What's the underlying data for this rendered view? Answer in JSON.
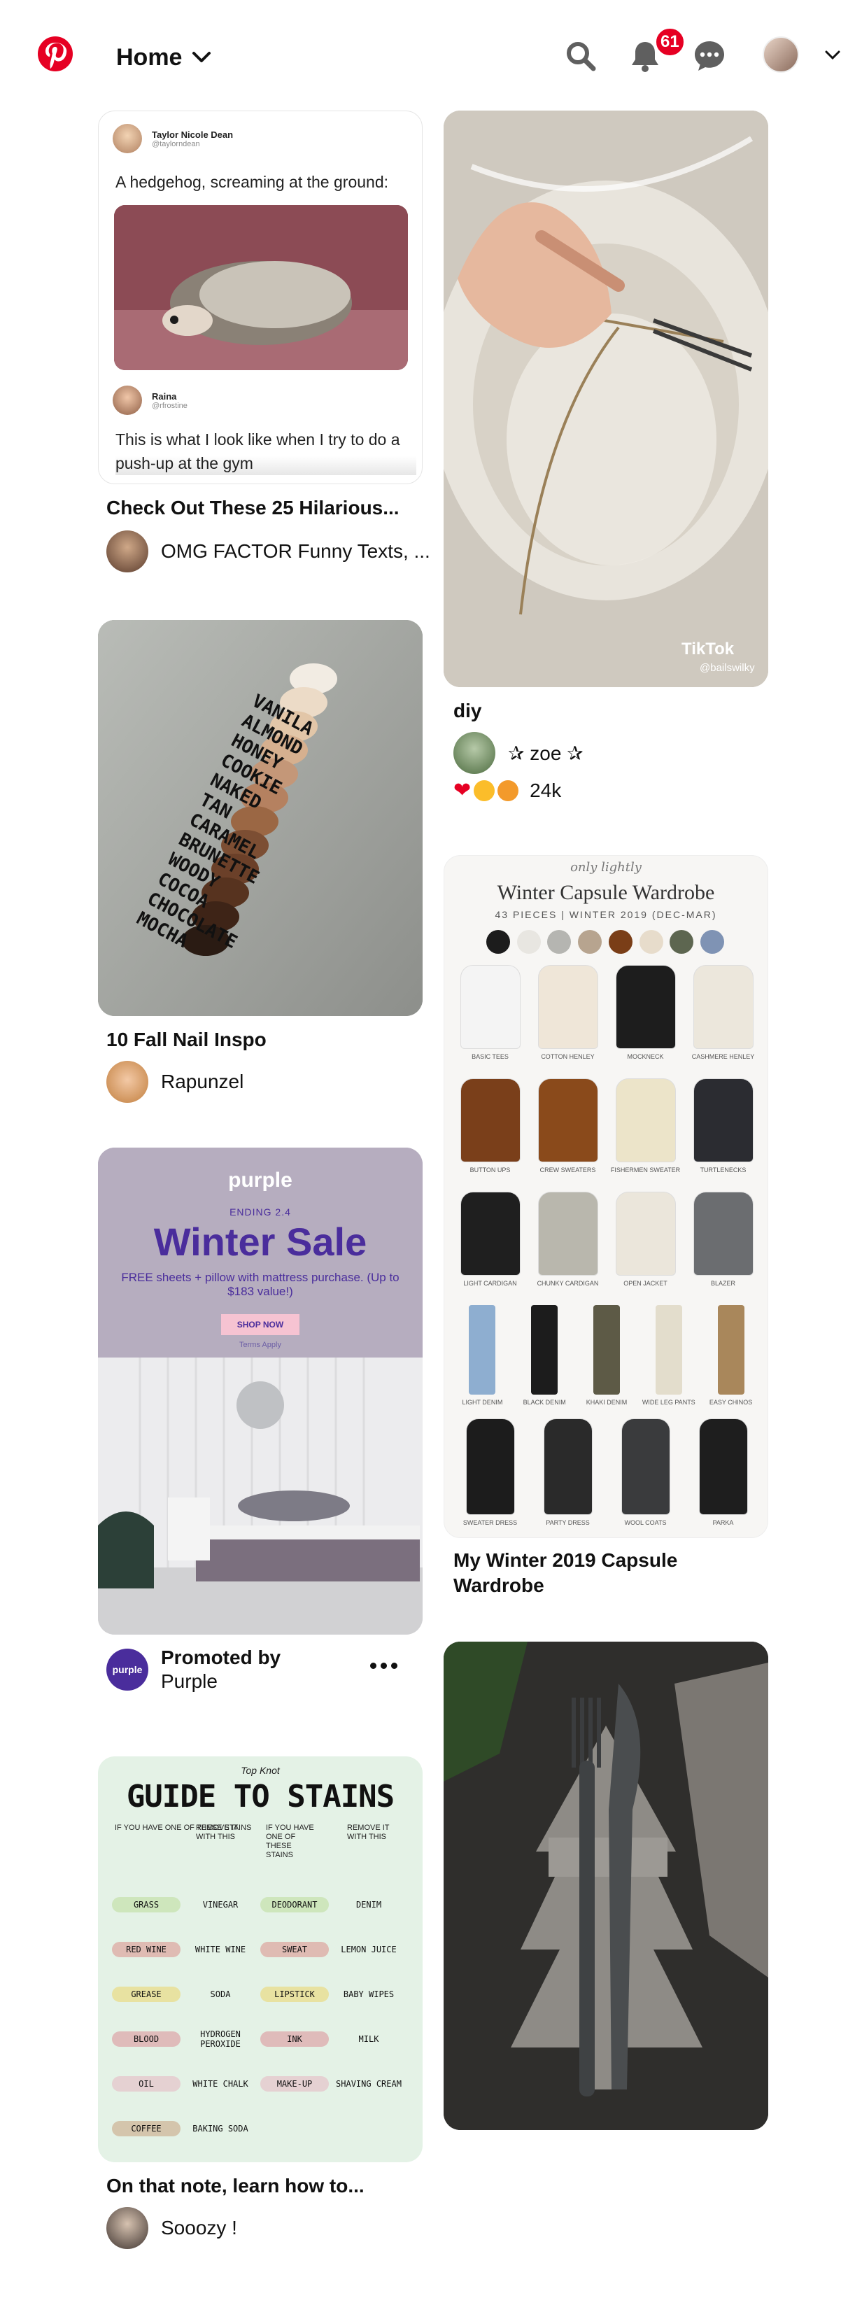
{
  "header": {
    "home_label": "Home",
    "notification_count": "61",
    "icons": [
      "pinterest-logo",
      "chevron-down-icon",
      "search-icon",
      "bell-icon",
      "chat-icon",
      "avatar",
      "chevron-down-icon"
    ]
  },
  "pins": {
    "tweet": {
      "tweet_name": "Taylor Nicole Dean",
      "tweet_handle": "@taylorndean",
      "tweet_text": "A hedgehog, screaming at the ground:",
      "reply_name": "Raina",
      "reply_handle": "@rfrostine",
      "reply_text": "This is what I look like when I try to do a push-up at the gym",
      "title": "Check Out These 25 Hilarious...",
      "author": "OMG FACTOR Funny Texts, ..."
    },
    "diy": {
      "watermark": "TikTok",
      "watermark_handle": "@bailswilky",
      "title": "diy",
      "author": "✰ zoe ✰",
      "reaction_count": "24k"
    },
    "nails": {
      "labels": [
        "VANILA",
        "ALMOND",
        "HONEY",
        "COOKIE",
        "NAKED",
        "TAN",
        "CARAMEL",
        "BRUNETTE",
        "WOODY",
        "COCOA",
        "CHOCOLATE",
        "MOCHA"
      ],
      "title": "10 Fall Nail Inspo",
      "author": "Rapunzel"
    },
    "capsule": {
      "script": "only lightly",
      "heading": "Winter Capsule Wardrobe",
      "subheading": "43 PIECES | WINTER 2019 (DEC-MAR)",
      "row_labels": [
        [
          "BASIC TEES",
          "COTTON HENLEY",
          "MOCKNECK",
          "CASHMERE HENLEY"
        ],
        [
          "BUTTON UPS",
          "CREW SWEATERS",
          "FISHERMEN SWEATER",
          "TURTLENECKS"
        ],
        [
          "LIGHT CARDIGAN",
          "CHUNKY CARDIGAN",
          "OPEN JACKET",
          "BLAZER"
        ],
        [
          "LIGHT DENIM",
          "BLACK DENIM",
          "KHAKI DENIM",
          "WIDE LEG PANTS",
          "EASY CHINOS"
        ],
        [
          "SWEATER DRESS",
          "PARTY DRESS",
          "WOOL COATS",
          "PARKA"
        ]
      ],
      "title": "My Winter 2019 Capsule Wardrobe"
    },
    "purple": {
      "brand": "purple",
      "ending": "ENDING 2.4",
      "headline": "Winter Sale",
      "offer": "FREE sheets + pillow with mattress purchase. (Up to $183 value!)",
      "cta": "SHOP NOW",
      "terms": "Terms Apply",
      "promoted_by": "Promoted by",
      "advertiser": "Purple",
      "avatar_text": "purple"
    },
    "stains": {
      "brand": "Top Knot",
      "heading": "GUIDE TO STAINS",
      "col_head_1": "IF YOU HAVE ONE OF THESE STAINS",
      "col_head_2": "REMOVE IT WITH THIS",
      "rows": [
        [
          "GRASS",
          "VINEGAR",
          "DEODORANT",
          "DENIM"
        ],
        [
          "RED WINE",
          "WHITE WINE",
          "SWEAT",
          "LEMON JUICE"
        ],
        [
          "GREASE",
          "SODA",
          "LIPSTICK",
          "BABY WIPES"
        ],
        [
          "BLOOD",
          "HYDROGEN PEROXIDE",
          "INK",
          "MILK"
        ],
        [
          "OIL",
          "WHITE CHALK",
          "MAKE-UP",
          "SHAVING CREAM"
        ],
        [
          "COFFEE",
          "BAKING SODA",
          "",
          ""
        ]
      ],
      "title": "On that note, learn how to...",
      "author": "Sooozy !"
    },
    "fork": {}
  },
  "colors": {
    "brand_red": "#e60023",
    "purple_brand": "#4a2d9c"
  },
  "capsule_swatches": [
    "#1c1c1c",
    "#e8e6e1",
    "#b5b5b1",
    "#b7a48f",
    "#7a3e17",
    "#e7dccb",
    "#5d6650",
    "#7f93b4"
  ]
}
